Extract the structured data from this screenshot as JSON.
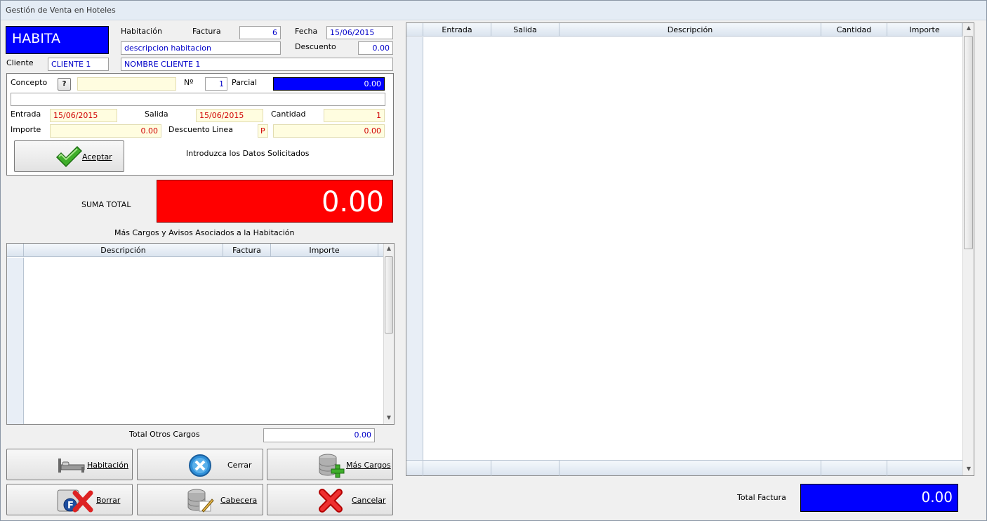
{
  "window": {
    "title": "Gestión de Venta en Hoteles"
  },
  "header": {
    "tipo": "HABITA",
    "habitacion_label": "Habitación",
    "factura_label": "Factura",
    "factura_value": "6",
    "fecha_label": "Fecha",
    "fecha_value": "15/06/2015",
    "descripcion_habitacion": "descripcion habitacion",
    "descuento_label": "Descuento",
    "descuento_value": "0.00",
    "cliente_label": "Cliente",
    "cliente_code": "CLIENTE 1",
    "cliente_name": "NOMBRE CLIENTE 1"
  },
  "concepto": {
    "concepto_label": "Concepto",
    "help_button": "?",
    "concepto_value": "",
    "numero_label": "Nº",
    "numero_value": "1",
    "parcial_label": "Parcial",
    "parcial_value": "0.00",
    "descripcion_value": "",
    "entrada_label": "Entrada",
    "entrada_value": "15/06/2015",
    "salida_label": "Salida",
    "salida_value": "15/06/2015",
    "cantidad_label": "Cantidad",
    "cantidad_value": "1",
    "importe_label": "Importe",
    "importe_value": "0.00",
    "descuento_linea_label": "Descuento Linea",
    "descuento_tipo": "P",
    "descuento_linea_value": "0.00",
    "aceptar_label": "Aceptar",
    "status_message": "Introduzca los Datos Solicitados"
  },
  "suma": {
    "label": "SUMA TOTAL",
    "value": "0.00"
  },
  "otros_cargos": {
    "title": "Más Cargos y Avisos Asociados a la Habitación",
    "columns": [
      "Descripción",
      "Factura",
      "Importe"
    ],
    "total_label": "Total Otros Cargos",
    "total_value": "0.00"
  },
  "buttons": {
    "habitacion": "Habitación",
    "cerrar": "Cerrar",
    "mas_cargos": "Más Cargos",
    "borrar": "Borrar",
    "cabecera": "Cabecera",
    "cancelar": "Cancelar"
  },
  "lineas": {
    "columns": [
      "Entrada",
      "Salida",
      "Descripción",
      "Cantidad",
      "Importe"
    ]
  },
  "total_factura": {
    "label": "Total Factura",
    "value": "0.00"
  },
  "colors": {
    "blue_field": "#0000ff",
    "red_total": "#ff0000",
    "yellow_input": "#fffde0"
  }
}
